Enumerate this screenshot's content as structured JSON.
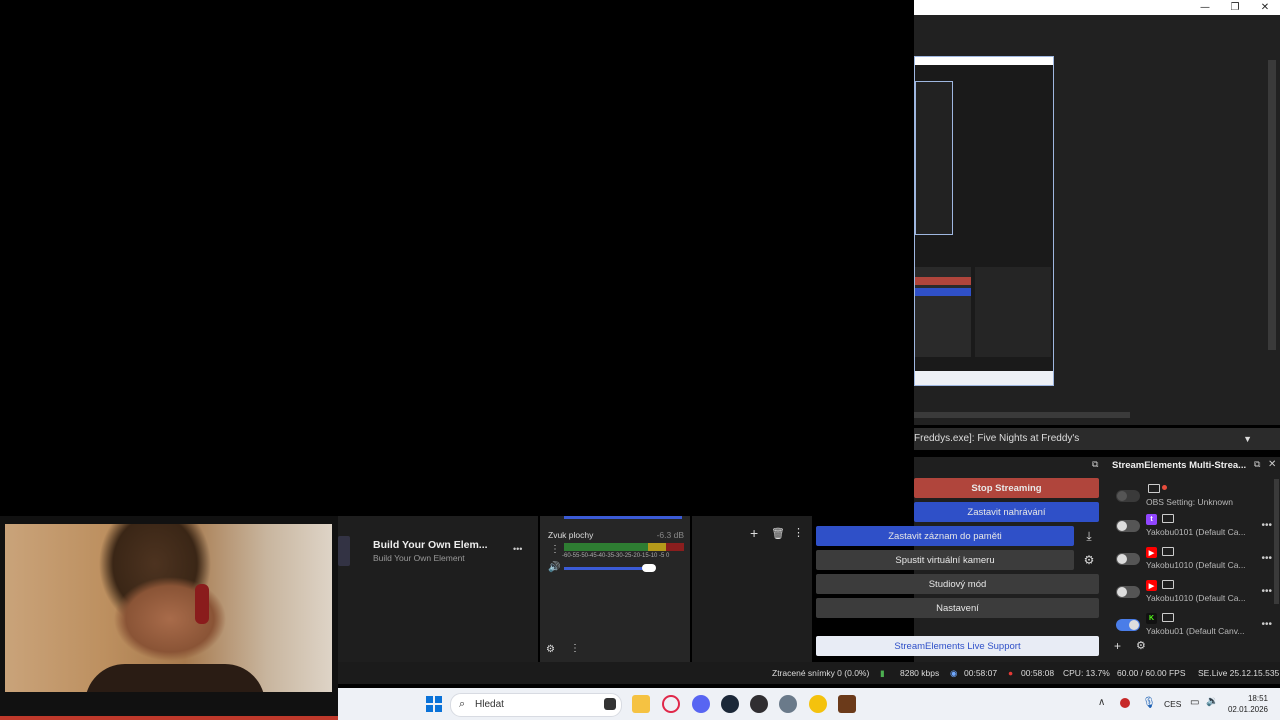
{
  "obs": {
    "scene_source": "Freddys.exe]: Five Nights at Freddy's",
    "controls": {
      "stop_streaming": "Stop Streaming",
      "stop_recording": "Zastavit nahrávání",
      "stop_replay": "Zastavit záznam do paměti",
      "start_virtualcam": "Spustit virtuální kameru",
      "studio_mode": "Studiový mód",
      "settings": "Nastavení",
      "se_support": "StreamElements Live Support"
    },
    "multistream": {
      "title": "StreamElements Multi-Strea...",
      "rows": [
        {
          "label": "OBS Setting: Unknown",
          "platform": "none",
          "state": "disabled"
        },
        {
          "label": "Yakobu0101 (Default Ca...",
          "platform": "twitch",
          "state": "off"
        },
        {
          "label": "Yakobu1010 (Default Ca...",
          "platform": "youtube",
          "state": "off"
        },
        {
          "label": "Yakobu1010 (Default Ca...",
          "platform": "youtube",
          "state": "off"
        },
        {
          "label": "Yakobu01 (Default Canv...",
          "platform": "kick",
          "state": "on"
        }
      ]
    },
    "source": {
      "title": "Build Your Own Elem...",
      "subtitle": "Build Your Own Element"
    },
    "mixer": {
      "channel": "Zvuk plochy",
      "level": "-6.3 dB",
      "scale": "-60-55-50-45-40-35-30-25-20-15-10 -5  0"
    },
    "status": {
      "dropped": "Ztracené snímky 0 (0.0%)",
      "bitrate": "8280 kbps",
      "stream_time": "00:58:07",
      "rec_time": "00:58:08",
      "cpu": "CPU: 13.7%",
      "fps": "60.00 / 60.00 FPS",
      "version": "SE.Live 25.12.15.535"
    }
  },
  "taskbar": {
    "search_placeholder": "Hledat",
    "lang": "CES",
    "time": "18:51",
    "date": "02.01.2026"
  },
  "colors": {
    "accent_blue": "#2f50c8",
    "stop_red": "#b0453c",
    "kick_green": "#53fc18",
    "twitch_purple": "#9146ff",
    "youtube_red": "#ff0000"
  }
}
